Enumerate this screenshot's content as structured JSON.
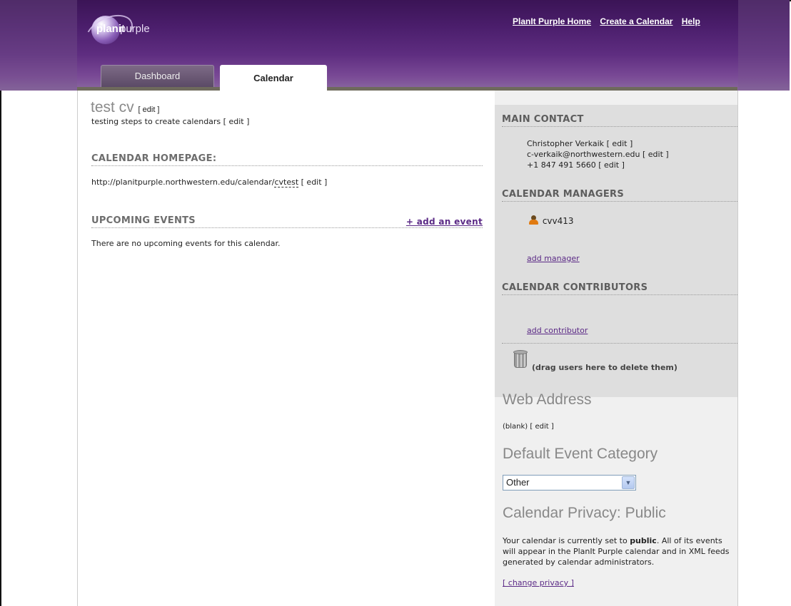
{
  "header": {
    "logo": {
      "word1": "planit",
      "word2": "purple"
    },
    "links": [
      "PlanIt Purple Home",
      "Create a Calendar",
      "Help"
    ],
    "tabs": {
      "dashboard": "Dashboard",
      "calendar": "Calendar"
    }
  },
  "calendar": {
    "title": "test cv",
    "title_edit": "[ edit ]",
    "description": "testing steps to create calendars",
    "description_edit": "[ edit ]"
  },
  "homepage": {
    "heading": "CALENDAR HOMEPAGE:",
    "url_prefix": "http://planitpurple.northwestern.edu/calendar/",
    "url_slug": "cvtest",
    "edit": "[ edit ]"
  },
  "upcoming": {
    "heading": "UPCOMING EVENTS",
    "add_event": "+ add an event",
    "empty_message": "There are no upcoming events for this calendar."
  },
  "sidebar": {
    "main_contact": {
      "heading": "MAIN CONTACT",
      "name": "Christopher Verkaik",
      "email": "c-verkaik@northwestern.edu",
      "phone": "+1 847 491 5660",
      "edit": "[ edit ]"
    },
    "managers": {
      "heading": "CALENDAR MANAGERS",
      "users": [
        "cvv413"
      ],
      "add_link": "add manager"
    },
    "contributors": {
      "heading": "CALENDAR CONTRIBUTORS",
      "add_link": "add contributor"
    },
    "trash_hint": "(drag users here to delete them)",
    "web_address": {
      "heading": "Web Address",
      "value": "(blank)",
      "edit": "[ edit ]"
    },
    "default_category": {
      "heading": "Default Event Category",
      "selected": "Other"
    },
    "privacy": {
      "heading": "Calendar Privacy: Public",
      "text_before": "Your calendar is currently set to ",
      "text_bold": "public",
      "text_after": ". All of its events will appear in the PlanIt Purple calendar and in XML feeds generated by calendar administrators.",
      "change_link": "[ change privacy ]"
    }
  },
  "colors": {
    "brand_purple": "#4b1e6c",
    "link_purple": "#5b2a86",
    "sidebar_grey": "#dedede"
  }
}
